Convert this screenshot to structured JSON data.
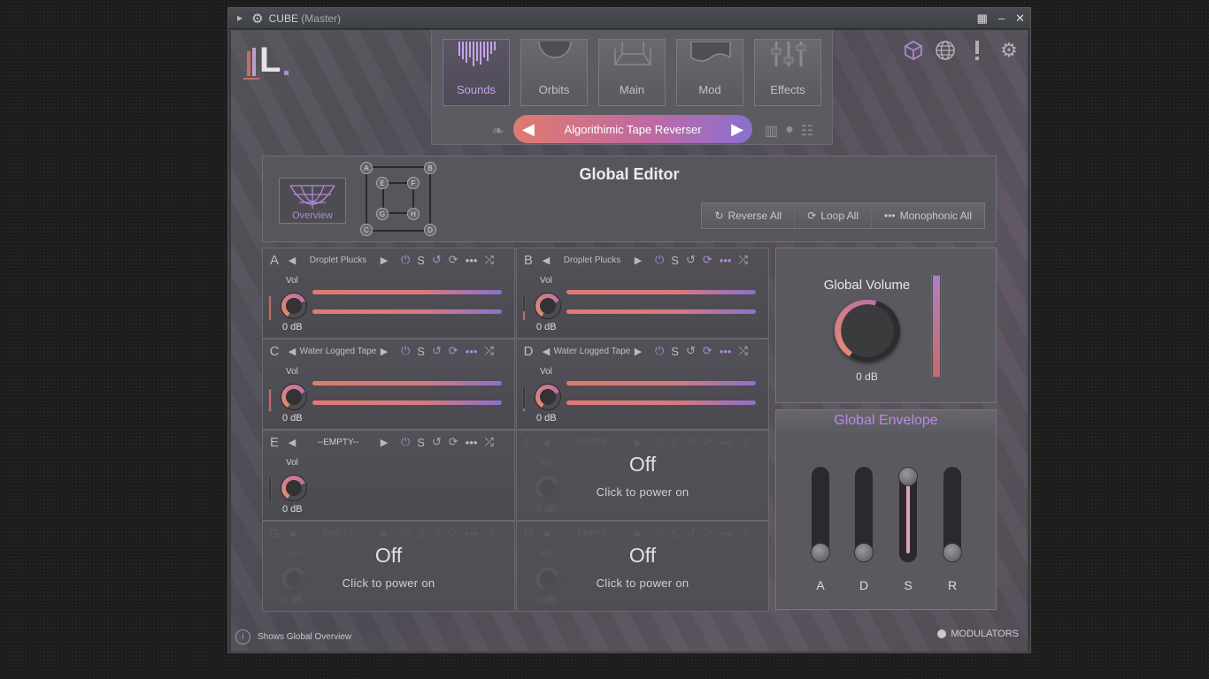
{
  "window": {
    "title": "CUBE",
    "subtitle": "(Master)"
  },
  "nav": {
    "tabs": [
      {
        "label": "Sounds"
      },
      {
        "label": "Orbits"
      },
      {
        "label": "Main"
      },
      {
        "label": "Mod"
      },
      {
        "label": "Effects"
      }
    ],
    "preset_name": "Algorithimic Tape Reverser"
  },
  "global_editor": {
    "title": "Global Editor",
    "overview_label": "Overview",
    "matrix_nodes": [
      "A",
      "B",
      "E",
      "F",
      "G",
      "H",
      "C",
      "D"
    ],
    "actions": [
      {
        "icon": "↻",
        "label": "Reverse All"
      },
      {
        "icon": "⟳",
        "label": "Loop All"
      },
      {
        "icon": "•••",
        "label": "Monophonic All"
      }
    ]
  },
  "slots": [
    {
      "letter": "A",
      "name": "Droplet Plucks",
      "vol_label": "Vol",
      "db": "0 dB",
      "state": "on",
      "meter_level": 0.95
    },
    {
      "letter": "B",
      "name": "Droplet Plucks",
      "vol_label": "Vol",
      "db": "0 dB",
      "state": "on",
      "meter_level": 0.35
    },
    {
      "letter": "C",
      "name": "Water Logged Tape",
      "vol_label": "Vol",
      "db": "0 dB",
      "state": "on",
      "meter_level": 0.9
    },
    {
      "letter": "D",
      "name": "Water Logged Tape",
      "vol_label": "Vol",
      "db": "0 dB",
      "state": "on",
      "meter_level": 0.1
    },
    {
      "letter": "E",
      "name": "--EMPTY--",
      "vol_label": "Vol",
      "db": "0 dB",
      "state": "empty",
      "meter_level": 0.0
    },
    {
      "letter": "F",
      "name": "--EMPTY--",
      "vol_label": "Vol",
      "db": "0 dB",
      "state": "off",
      "meter_level": 0.0
    },
    {
      "letter": "G",
      "name": "--EMPTY--",
      "vol_label": "Vol",
      "db": "0 dB",
      "state": "off",
      "meter_level": 0.0
    },
    {
      "letter": "H",
      "name": "--EMPTY--",
      "vol_label": "Vol",
      "db": "0 dB",
      "state": "off",
      "meter_level": 0.0
    }
  ],
  "slot_off": {
    "title": "Off",
    "hint": "Click to power on"
  },
  "global_volume": {
    "title": "Global Volume",
    "db": "0 dB",
    "meter_level": 1.0
  },
  "global_envelope": {
    "title": "Global Envelope",
    "sliders": [
      {
        "label": "A",
        "value": 0.0
      },
      {
        "label": "D",
        "value": 0.0
      },
      {
        "label": "S",
        "value": 1.0
      },
      {
        "label": "R",
        "value": 0.0
      }
    ]
  },
  "footer": {
    "info_icon": "i",
    "info_text": "Shows Global Overview",
    "modulators_label": "MODULATORS"
  },
  "colors": {
    "accent_purple": "#b087d8",
    "accent_coral": "#e07a70",
    "panel_bg": "#57565c"
  }
}
